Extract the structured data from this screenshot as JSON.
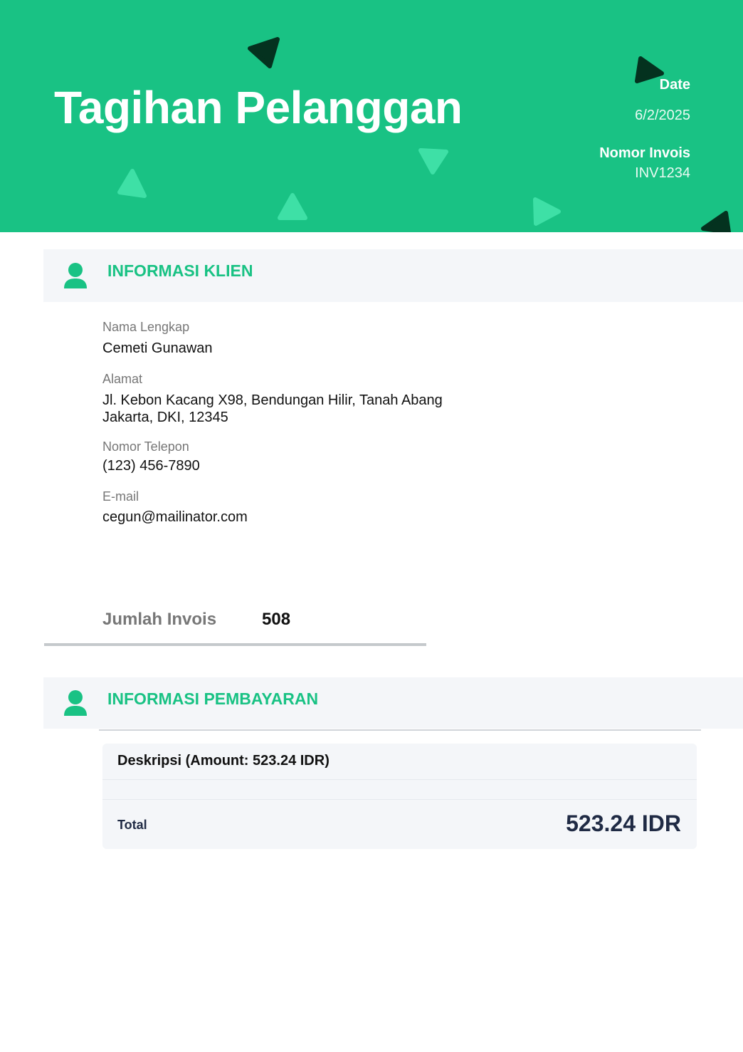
{
  "header": {
    "title": "Tagihan Pelanggan",
    "date_label": "Date",
    "date_value": "6/2/2025",
    "invoice_label": "Nomor Invois",
    "invoice_value": "INV1234"
  },
  "colors": {
    "brand_green": "#19c284",
    "dark_green": "#04321f",
    "light_green": "#3ee0a6",
    "navy": "#1f2a44"
  },
  "client_section": {
    "heading": "INFORMASI KLIEN",
    "icon": "user-icon",
    "fields": [
      {
        "label": "Nama Lengkap",
        "value": "Cemeti Gunawan"
      },
      {
        "label": "Alamat",
        "value_line1": "Jl. Kebon Kacang X98, Bendungan Hilir, Tanah Abang",
        "value_line2": "Jakarta, DKI, 12345"
      },
      {
        "label": "Nomor Telepon",
        "value": "(123) 456-7890"
      },
      {
        "label": "E-mail",
        "value": "cegun@mailinator.com"
      }
    ]
  },
  "invoice_count": {
    "label": "Jumlah Invois",
    "value": "508"
  },
  "payment_section": {
    "heading": "INFORMASI PEMBAYARAN",
    "icon": "user-icon",
    "description": "Deskripsi (Amount: 523.24 IDR)",
    "total_label": "Total",
    "total_value": "523.24 IDR"
  }
}
